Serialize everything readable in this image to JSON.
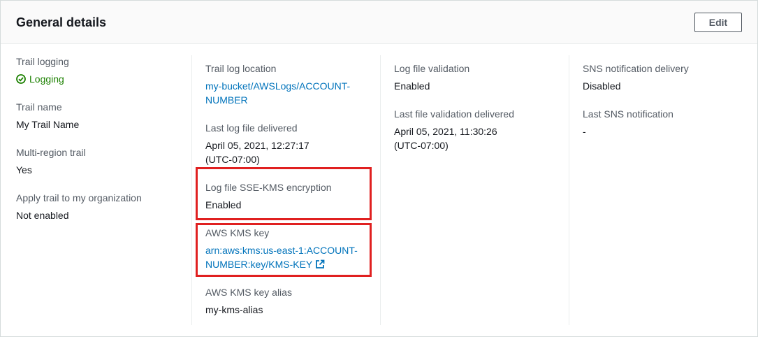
{
  "header": {
    "title": "General details",
    "edit_label": "Edit"
  },
  "column1": {
    "trail_logging_label": "Trail logging",
    "trail_logging_value": "Logging",
    "trail_name_label": "Trail name",
    "trail_name_value": "My Trail Name",
    "multi_region_label": "Multi-region trail",
    "multi_region_value": "Yes",
    "org_label": "Apply trail to my organization",
    "org_value": "Not enabled"
  },
  "column2": {
    "log_location_label": "Trail log location",
    "log_location_line1": "my-bucket/AWSLogs/ACCOUNT-",
    "log_location_line2": "NUMBER",
    "last_delivered_label": "Last log file delivered",
    "last_delivered_line1": "April 05, 2021, 12:27:17",
    "last_delivered_line2": "(UTC-07:00)",
    "sse_label": "Log file SSE-KMS encryption",
    "sse_value": "Enabled",
    "kms_key_label": "AWS KMS key",
    "kms_key_line1": "arn:aws:kms:us-east-1:ACCOUNT-",
    "kms_key_line2": "NUMBER:key/KMS-KEY",
    "kms_alias_label": "AWS KMS key alias",
    "kms_alias_value": "my-kms-alias"
  },
  "column3": {
    "validation_label": "Log file validation",
    "validation_value": "Enabled",
    "last_validation_label": "Last file validation delivered",
    "last_validation_line1": "April 05, 2021, 11:30:26",
    "last_validation_line2": "(UTC-07:00)"
  },
  "column4": {
    "sns_label": "SNS notification delivery",
    "sns_value": "Disabled",
    "last_sns_label": "Last SNS notification",
    "last_sns_value": "-"
  },
  "colors": {
    "link": "#0073bb",
    "success": "#1d8102",
    "highlight": "#e02020",
    "label": "#545b64"
  },
  "icons": {
    "status": "check-circle-icon",
    "external": "external-link-icon"
  }
}
